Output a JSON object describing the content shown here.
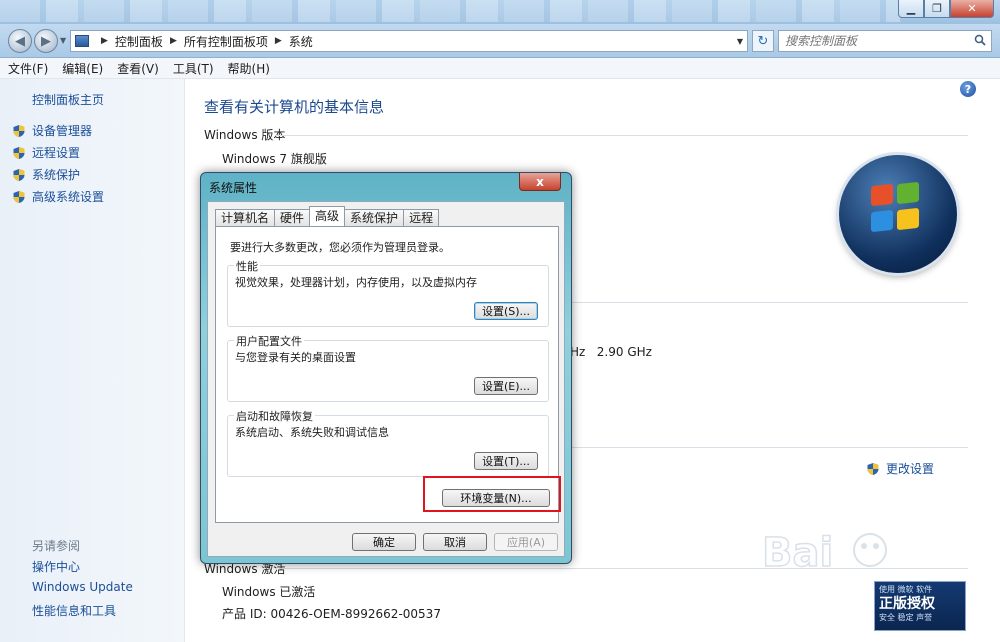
{
  "window": {
    "controls": [
      "minimize",
      "restore",
      "close"
    ]
  },
  "address": {
    "crumbs": [
      "控制面板",
      "所有控制面板项",
      "系统"
    ],
    "search_placeholder": "搜索控制面板"
  },
  "menu": [
    "文件(F)",
    "编辑(E)",
    "查看(V)",
    "工具(T)",
    "帮助(H)"
  ],
  "left": {
    "home": "控制面板主页",
    "links": [
      "设备管理器",
      "远程设置",
      "系统保护",
      "高级系统设置"
    ],
    "see_also": "另请参阅",
    "footer_links": [
      "操作中心",
      "Windows Update",
      "性能信息和工具"
    ]
  },
  "main": {
    "help": "?",
    "title": "查看有关计算机的基本信息",
    "edition_section": "Windows 版本",
    "edition": "Windows 7 旗舰版",
    "cpu_prefix": "Hz",
    "cpu_speed": "2.90 GHz",
    "change_settings": "更改设置",
    "activation_section": "Windows 激活",
    "activation_status": "Windows 已激活",
    "product_id": "产品 ID: 00426-OEM-8992662-00537"
  },
  "dialog": {
    "title": "系统属性",
    "close": "x",
    "tabs": [
      "计算机名",
      "硬件",
      "高级",
      "系统保护",
      "远程"
    ],
    "active_tab": 2,
    "admin_note": "要进行大多数更改，您必须作为管理员登录。",
    "groups": [
      {
        "title": "性能",
        "desc": "视觉效果，处理器计划，内存使用，以及虚拟内存",
        "button": "设置(S)..."
      },
      {
        "title": "用户配置文件",
        "desc": "与您登录有关的桌面设置",
        "button": "设置(E)..."
      },
      {
        "title": "启动和故障恢复",
        "desc": "系统启动、系统失败和调试信息",
        "button": "设置(T)..."
      }
    ],
    "env_button": "环境变量(N)...",
    "ok": "确定",
    "cancel": "取消",
    "apply": "应用(A)"
  },
  "badge": {
    "line1": "使用 微软 软件",
    "big": "正版授权",
    "line3": "安全 稳定 声誉"
  },
  "colors": {
    "link": "#1b4f99",
    "title": "#1c4a8f",
    "highlight": "#e0141e",
    "dialog_frame": "#8fd0db"
  }
}
